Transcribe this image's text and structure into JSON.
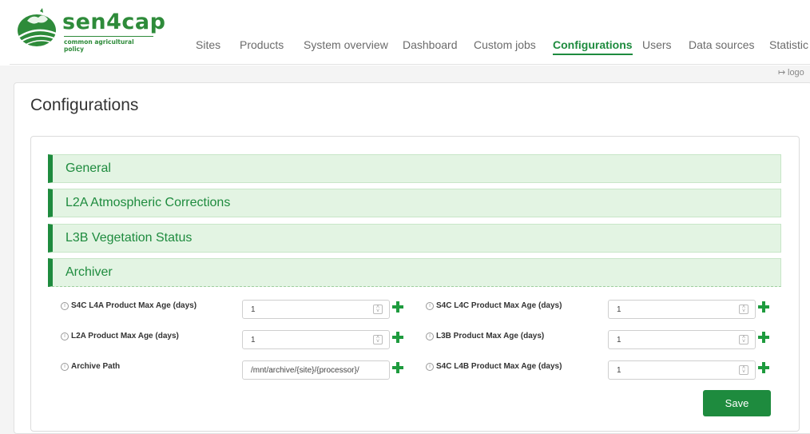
{
  "logo": {
    "title": "sen4cap",
    "subtitle": "common agricultural policy"
  },
  "nav": {
    "items": [
      {
        "label": "Sites"
      },
      {
        "label": "Products"
      },
      {
        "label": "System overview"
      },
      {
        "label": "Dashboard"
      },
      {
        "label": "Custom jobs"
      },
      {
        "label": "Configurations",
        "active": true
      },
      {
        "label": "Users"
      },
      {
        "label": "Data sources"
      },
      {
        "label": "Statistic"
      }
    ]
  },
  "logoff": {
    "label": "logo"
  },
  "page": {
    "title": "Configurations"
  },
  "accordion": [
    {
      "label": "General"
    },
    {
      "label": "L2A Atmospheric Corrections"
    },
    {
      "label": "L3B Vegetation Status"
    },
    {
      "label": "Archiver",
      "open": true
    }
  ],
  "archiver": {
    "left": [
      {
        "label": "S4C L4A Product Max Age (days)",
        "value": "1"
      },
      {
        "label": "L2A Product Max Age (days)",
        "value": "1"
      },
      {
        "label": "Archive Path",
        "value": "/mnt/archive/{site}/{processor}/"
      }
    ],
    "right": [
      {
        "label": "S4C L4C Product Max Age (days)",
        "value": "1"
      },
      {
        "label": "L3B Product Max Age (days)",
        "value": "1"
      },
      {
        "label": "S4C L4B Product Max Age (days)",
        "value": "1"
      }
    ],
    "save_label": "Save"
  },
  "colors": {
    "accent": "#1e8b3e",
    "accordion_bg": "#e3f4e3"
  }
}
